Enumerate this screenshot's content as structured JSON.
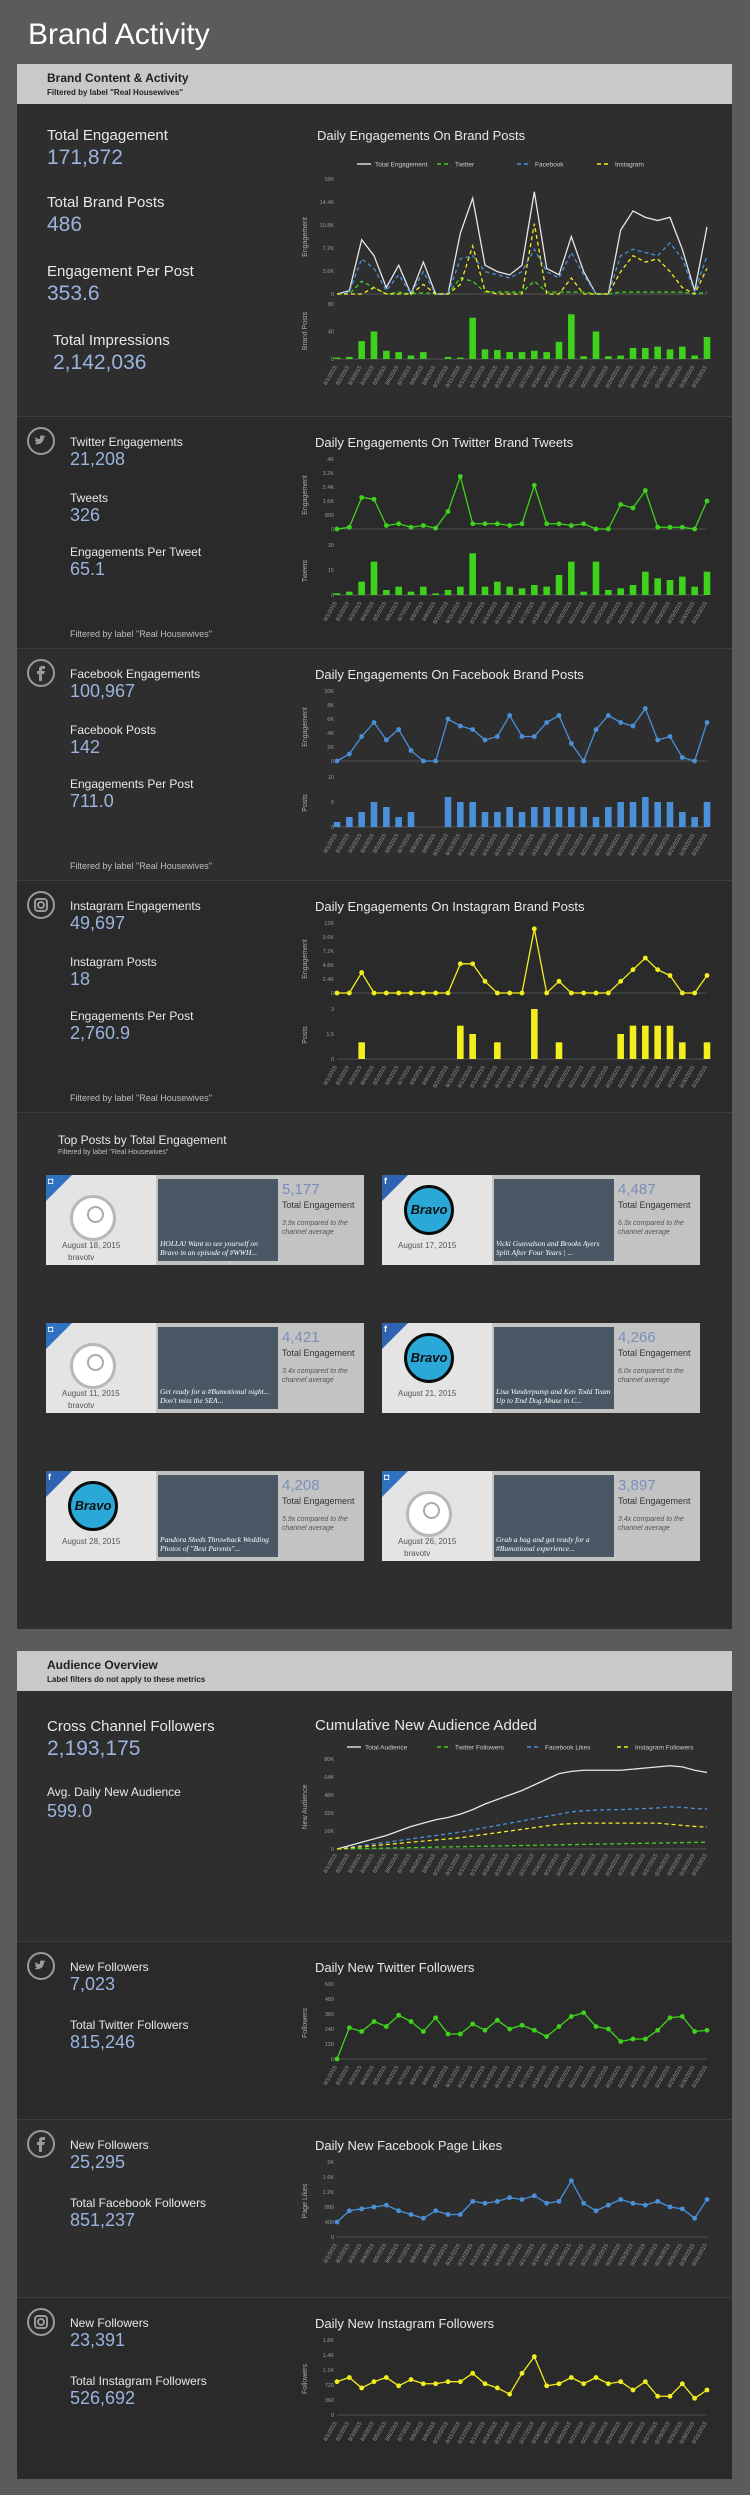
{
  "page_title": "Brand Activity",
  "brand": {
    "header": "Brand Content & Activity",
    "filter": "Filtered by label \"Real Housewives\"",
    "total_engagement_label": "Total Engagement",
    "total_engagement": "171,872",
    "total_posts_label": "Total Brand Posts",
    "total_posts": "486",
    "epp_label": "Engagement Per Post",
    "epp": "353.6",
    "impressions_label": "Total Impressions",
    "impressions": "2,142,036",
    "chart_title": "Daily Engagements On Brand Posts",
    "legend": [
      "Total Engagement",
      "Twitter",
      "Facebook",
      "Instagram"
    ],
    "y_label": "Engagement",
    "y2_label": "Brand Posts"
  },
  "twitter": {
    "eng_label": "Twitter Engagements",
    "eng": "21,208",
    "posts_label": "Tweets",
    "posts": "326",
    "epp_label": "Engagements Per Tweet",
    "epp": "65.1",
    "filter": "Filtered by label \"Real Housewives\"",
    "chart_title": "Daily Engagements On Twitter Brand Tweets",
    "y_label": "Engagement",
    "y2_label": "Tweets",
    "icon": "twitter-icon"
  },
  "facebook": {
    "eng_label": "Facebook Engagements",
    "eng": "100,967",
    "posts_label": "Facebook Posts",
    "posts": "142",
    "epp_label": "Engagements Per Post",
    "epp": "711.0",
    "filter": "Filtered by label \"Real Housewives\"",
    "chart_title": "Daily Engagements On Facebook Brand Posts",
    "y_label": "Engagement",
    "y2_label": "Posts",
    "icon": "facebook-icon"
  },
  "instagram": {
    "eng_label": "Instagram Engagements",
    "eng": "49,697",
    "posts_label": "Instagram Posts",
    "posts": "18",
    "epp_label": "Engagements Per Post",
    "epp": "2,760.9",
    "filter": "Filtered by label \"Real Housewives\"",
    "chart_title": "Daily Engagements On Instagram Brand Posts",
    "y_label": "Engagement",
    "y2_label": "Posts",
    "icon": "instagram-icon"
  },
  "top_posts": {
    "title": "Top Posts by Total Engagement",
    "filter": "Filtered by label \"Real Housewives\"",
    "metric_label": "Total Engagement",
    "items": [
      {
        "network": "instagram",
        "date": "August 18, 2015",
        "account": "bravotv",
        "value": "5,177",
        "compare": "3.9x compared to the channel average",
        "caption": "HOLLA! Want to see yourself on Bravo in an episode of #WWH..."
      },
      {
        "network": "facebook",
        "date": "August 17, 2015",
        "account": "",
        "value": "4,487",
        "compare": "6.3x compared to the channel average",
        "caption": "Vicki Gunvalson and Brooks Ayers Split After Four Years | ..."
      },
      {
        "network": "instagram",
        "date": "August 11, 2015",
        "account": "bravotv",
        "value": "4,421",
        "compare": "3.4x compared to the channel average",
        "caption": "Get ready for a #Bumotional night... Don't miss the SEA..."
      },
      {
        "network": "facebook",
        "date": "August 21, 2015",
        "account": "",
        "value": "4,266",
        "compare": "6.0x compared to the channel average",
        "caption": "Lisa Vanderpump and Ken Todd Team Up to End Dog Abuse in C..."
      },
      {
        "network": "facebook",
        "date": "August 28, 2015",
        "account": "",
        "value": "4,208",
        "compare": "5.9x compared to the channel average",
        "caption": "Pandora Sheds Throwback Wedding Photos of \"Best Parents\"..."
      },
      {
        "network": "instagram",
        "date": "August 26, 2015",
        "account": "bravotv",
        "value": "3,897",
        "compare": "3.4x compared to the channel average",
        "caption": "Grab a bag and get ready for a #Bumotional experience..."
      }
    ]
  },
  "audience": {
    "header": "Audience Overview",
    "sub": "Label filters do not apply to these metrics",
    "followers_label": "Cross Channel Followers",
    "followers": "2,193,175",
    "avg_label": "Avg. Daily New Audience",
    "avg": "599.0",
    "chart_title": "Cumulative New Audience Added",
    "legend": [
      "Total Audience",
      "Twitter Followers",
      "Facebook Likes",
      "Instagram Followers"
    ],
    "y_label": "New Audience"
  },
  "aud_twitter": {
    "new_label": "New Followers",
    "new": "7,023",
    "total_label": "Total Twitter Followers",
    "total": "815,246",
    "chart_title": "Daily New Twitter Followers",
    "y_label": "Followers"
  },
  "aud_facebook": {
    "new_label": "New Followers",
    "new": "25,295",
    "total_label": "Total Facebook Followers",
    "total": "851,237",
    "chart_title": "Daily New Facebook Page Likes",
    "y_label": "Page Likes"
  },
  "aud_instagram": {
    "new_label": "New Followers",
    "new": "23,391",
    "total_label": "Total Instagram Followers",
    "total": "526,692",
    "chart_title": "Daily New Instagram Followers",
    "y_label": "Followers"
  },
  "colors": {
    "total": "#e6e6e6",
    "twitter": "#3fd21c",
    "facebook": "#4a90d9",
    "instagram": "#f3ef1e"
  },
  "chart_data": [
    {
      "type": "line",
      "title": "Daily Engagements On Brand Posts",
      "ylabel": "Engagement",
      "ylim": [
        0,
        18000
      ],
      "x": [
        "8/1/2015",
        "8/2/2015",
        "8/3/2015",
        "8/4/2015",
        "8/5/2015",
        "8/6/2015",
        "8/7/2015",
        "8/8/2015",
        "8/9/2015",
        "8/10/2015",
        "8/11/2015",
        "8/12/2015",
        "8/13/2015",
        "8/14/2015",
        "8/15/2015",
        "8/16/2015",
        "8/17/2015",
        "8/18/2015",
        "8/19/2015",
        "8/20/2015",
        "8/21/2015",
        "8/22/2015",
        "8/23/2015",
        "8/24/2015",
        "8/25/2015",
        "8/26/2015",
        "8/27/2015",
        "8/28/2015",
        "8/29/2015",
        "8/30/2015",
        "8/31/2015"
      ],
      "series": [
        {
          "name": "Total Engagement",
          "values": [
            0,
            500,
            8500,
            6000,
            1000,
            4500,
            0,
            5000,
            0,
            0,
            9500,
            15000,
            4500,
            3500,
            3000,
            4500,
            16000,
            4000,
            3000,
            9000,
            3500,
            0,
            0,
            10000,
            13000,
            12000,
            11500,
            12000,
            7000,
            500,
            10500
          ]
        },
        {
          "name": "Twitter",
          "values": [
            0,
            0,
            2000,
            1000,
            0,
            300,
            0,
            200,
            0,
            0,
            2500,
            2000,
            300,
            300,
            300,
            300,
            2000,
            300,
            300,
            300,
            300,
            0,
            0,
            300,
            300,
            300,
            300,
            300,
            300,
            0,
            300
          ]
        },
        {
          "name": "Facebook",
          "values": [
            0,
            300,
            5500,
            4000,
            500,
            3000,
            0,
            3500,
            0,
            0,
            5500,
            6000,
            3500,
            3000,
            2500,
            3500,
            7000,
            3500,
            2500,
            6500,
            3000,
            0,
            0,
            6000,
            7000,
            6500,
            6000,
            8000,
            5500,
            300,
            6000
          ]
        },
        {
          "name": "Instagram",
          "values": [
            0,
            0,
            0,
            1000,
            0,
            0,
            0,
            1500,
            0,
            0,
            1500,
            7500,
            500,
            0,
            0,
            0,
            11000,
            0,
            0,
            2500,
            0,
            0,
            0,
            3500,
            6000,
            5000,
            5500,
            3500,
            1000,
            0,
            4000
          ]
        }
      ]
    },
    {
      "type": "bar",
      "title": "Brand Posts",
      "ylabel": "Brand Posts",
      "ylim": [
        0,
        80
      ],
      "series": [
        {
          "name": "Brand Posts",
          "values": [
            2,
            3,
            26,
            40,
            12,
            10,
            5,
            10,
            0,
            3,
            2,
            60,
            14,
            13,
            10,
            10,
            12,
            10,
            25,
            65,
            4,
            40,
            4,
            5,
            16,
            16,
            18,
            14,
            18,
            5,
            32
          ]
        }
      ]
    },
    {
      "type": "line",
      "title": "Daily Engagements On Twitter Brand Tweets",
      "ylabel": "Engagement",
      "ylim": [
        0,
        4000
      ],
      "series": [
        {
          "name": "Twitter",
          "values": [
            0,
            100,
            1800,
            1700,
            200,
            300,
            100,
            200,
            50,
            1000,
            3000,
            300,
            300,
            300,
            200,
            300,
            2500,
            300,
            300,
            200,
            300,
            0,
            0,
            1400,
            1200,
            2200,
            100,
            100,
            100,
            0,
            1600
          ]
        }
      ]
    },
    {
      "type": "bar",
      "title": "Tweets",
      "ylabel": "Tweets",
      "ylim": [
        0,
        30
      ],
      "series": [
        {
          "name": "Tweets",
          "values": [
            1,
            2,
            8,
            20,
            3,
            5,
            2,
            5,
            1,
            3,
            5,
            25,
            5,
            8,
            5,
            4,
            6,
            5,
            12,
            20,
            2,
            20,
            3,
            4,
            6,
            14,
            10,
            9,
            11,
            5,
            14
          ]
        }
      ]
    },
    {
      "type": "line",
      "title": "Daily Engagements On Facebook Brand Posts",
      "ylabel": "Engagement",
      "ylim": [
        0,
        10000
      ],
      "series": [
        {
          "name": "Facebook",
          "values": [
            0,
            1000,
            3500,
            5500,
            3000,
            4500,
            1500,
            0,
            0,
            6000,
            5000,
            4500,
            3000,
            3500,
            6500,
            3500,
            3500,
            5500,
            6500,
            2500,
            0,
            4500,
            6500,
            5500,
            5000,
            7500,
            3000,
            3500,
            500,
            0,
            5500
          ]
        }
      ]
    },
    {
      "type": "bar",
      "title": "Facebook Posts",
      "ylabel": "Posts",
      "ylim": [
        0,
        10
      ],
      "series": [
        {
          "name": "Posts",
          "values": [
            1,
            2,
            3,
            5,
            4,
            2,
            3,
            0,
            0,
            6,
            5,
            5,
            3,
            3,
            4,
            3,
            4,
            4,
            4,
            4,
            4,
            2,
            4,
            5,
            5,
            6,
            5,
            5,
            3,
            2,
            5
          ]
        }
      ]
    },
    {
      "type": "line",
      "title": "Daily Engagements On Instagram Brand Posts",
      "ylabel": "Engagement",
      "ylim": [
        0,
        12000
      ],
      "series": [
        {
          "name": "Instagram",
          "values": [
            0,
            0,
            3500,
            0,
            0,
            0,
            0,
            0,
            0,
            0,
            5000,
            5000,
            2000,
            0,
            0,
            0,
            11000,
            0,
            2000,
            0,
            0,
            0,
            0,
            2000,
            4000,
            6000,
            4000,
            3000,
            0,
            0,
            3000
          ]
        }
      ]
    },
    {
      "type": "bar",
      "title": "Instagram Posts",
      "ylabel": "Posts",
      "ylim": [
        0,
        3
      ],
      "series": [
        {
          "name": "Posts",
          "values": [
            0,
            0,
            1,
            0,
            0,
            0,
            0,
            0,
            0,
            0,
            2,
            1.5,
            0,
            1,
            0,
            0,
            3,
            0,
            1,
            0,
            0,
            0,
            0,
            1.5,
            2,
            2,
            2,
            2,
            1,
            0,
            1
          ]
        }
      ]
    },
    {
      "type": "line",
      "title": "Cumulative New Audience Added",
      "ylabel": "New Audience",
      "ylim": [
        0,
        80000
      ],
      "series": [
        {
          "name": "Total Audience",
          "values": [
            0,
            3000,
            6000,
            9000,
            12000,
            16000,
            20000,
            23000,
            26000,
            28000,
            31000,
            35000,
            40000,
            44000,
            48000,
            52000,
            57000,
            62000,
            67000,
            69000,
            70000,
            70000,
            70000,
            70000,
            71000,
            72000,
            73000,
            74000,
            73000,
            70000,
            68000
          ]
        },
        {
          "name": "Twitter Followers",
          "values": [
            0,
            200,
            400,
            600,
            800,
            1000,
            1200,
            1400,
            1700,
            1900,
            2100,
            2300,
            2500,
            2700,
            2900,
            3100,
            3300,
            3500,
            3700,
            3900,
            4100,
            4300,
            4500,
            4700,
            4900,
            5100,
            5300,
            5500,
            5700,
            5900,
            6000
          ]
        },
        {
          "name": "Facebook Likes",
          "values": [
            0,
            1500,
            3000,
            4500,
            6000,
            7500,
            9000,
            10500,
            12000,
            13500,
            15000,
            17000,
            19000,
            21000,
            23000,
            25000,
            27000,
            29000,
            31000,
            33000,
            34000,
            34500,
            35000,
            35000,
            35500,
            36000,
            36500,
            37500,
            37000,
            36000,
            35500
          ]
        },
        {
          "name": "Instagram Followers",
          "values": [
            0,
            1000,
            2000,
            3000,
            4000,
            5000,
            6000,
            7000,
            8000,
            9000,
            10000,
            11500,
            13000,
            14500,
            16000,
            17500,
            19000,
            20500,
            22000,
            22500,
            23000,
            23000,
            23000,
            23000,
            23000,
            23000,
            23000,
            22000,
            21000,
            20000,
            19500
          ]
        }
      ]
    },
    {
      "type": "line",
      "title": "Daily New Twitter Followers",
      "ylabel": "Followers",
      "ylim": [
        0,
        600
      ],
      "series": [
        {
          "name": "Twitter",
          "values": [
            0,
            250,
            220,
            300,
            260,
            350,
            300,
            220,
            330,
            200,
            200,
            280,
            230,
            310,
            240,
            270,
            230,
            180,
            260,
            340,
            370,
            260,
            240,
            140,
            160,
            160,
            230,
            330,
            340,
            220,
            230
          ]
        }
      ]
    },
    {
      "type": "line",
      "title": "Daily New Facebook Page Likes",
      "ylabel": "Page Likes",
      "ylim": [
        0,
        2000
      ],
      "series": [
        {
          "name": "Facebook",
          "values": [
            400,
            700,
            750,
            800,
            850,
            700,
            600,
            500,
            700,
            600,
            600,
            950,
            900,
            950,
            1050,
            1000,
            1100,
            900,
            950,
            1500,
            900,
            700,
            850,
            1000,
            900,
            850,
            950,
            800,
            750,
            500,
            1000
          ]
        }
      ]
    },
    {
      "type": "line",
      "title": "Daily New Instagram Followers",
      "ylabel": "Followers",
      "ylim": [
        0,
        1800
      ],
      "series": [
        {
          "name": "Instagram",
          "values": [
            800,
            900,
            650,
            800,
            900,
            700,
            850,
            750,
            750,
            800,
            800,
            1000,
            750,
            650,
            500,
            1000,
            1400,
            700,
            750,
            900,
            750,
            900,
            750,
            800,
            600,
            800,
            450,
            450,
            750,
            400,
            600
          ]
        }
      ]
    }
  ]
}
